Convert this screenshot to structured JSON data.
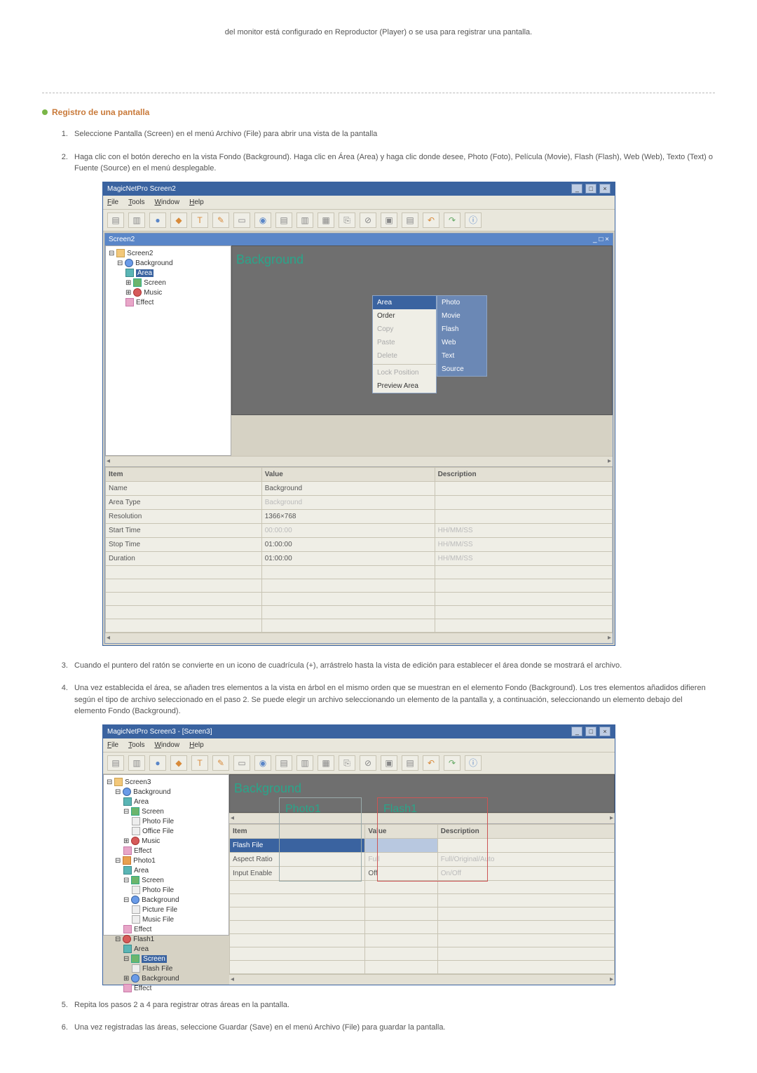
{
  "intro": "del monitor está configurado en Reproductor (Player) o se usa para registrar una pantalla.",
  "section_title": "Registro de una pantalla",
  "steps": {
    "s1": "Seleccione Pantalla (Screen) en el menú Archivo (File) para abrir una vista de la pantalla",
    "s2": "Haga clic con el botón derecho en la vista Fondo (Background). Haga clic en Área (Area) y haga clic donde desee, Photo (Foto), Película (Movie), Flash (Flash), Web (Web), Texto (Text) o Fuente (Source) en el menú desplegable.",
    "s3": "Cuando el puntero del ratón se convierte en un icono de cuadrícula (+), arrástrelo hasta la vista de edición para establecer el área donde se mostrará el archivo.",
    "s4": "Una vez establecida el área, se añaden tres elementos a la vista en árbol en el mismo orden que se muestran en el elemento Fondo (Background). Los tres elementos añadidos difieren según el tipo de archivo seleccionado en el paso 2. Se puede elegir un archivo seleccionando un elemento de la pantalla y, a continuación, seleccionando un elemento debajo del elemento Fondo (Background).",
    "s5": "Repita los pasos 2 a 4 para registrar otras áreas en la pantalla.",
    "s6": "Una vez registradas las áreas, seleccione Guardar (Save) en el menú Archivo (File) para guardar la pantalla."
  },
  "app1": {
    "title": "MagicNetPro Screen2",
    "menu": {
      "file": "File",
      "tools": "Tools",
      "window": "Window",
      "help": "Help"
    },
    "inner_title": "Screen2",
    "canvas_label": "Background",
    "tree": {
      "root": "Screen2",
      "bg": "Background",
      "area": "Area",
      "screen": "Screen",
      "music": "Music",
      "effect": "Effect"
    },
    "ctx": {
      "area": "Area",
      "order": "Order",
      "copy": "Copy",
      "paste": "Paste",
      "delete": "Delete",
      "lock": "Lock Position",
      "preview": "Preview Area"
    },
    "sub": {
      "photo": "Photo",
      "movie": "Movie",
      "flash": "Flash",
      "web": "Web",
      "text": "Text",
      "source": "Source"
    },
    "grid": {
      "h1": "Item",
      "h2": "Value",
      "h3": "Description",
      "r1c1": "Name",
      "r1c2": "Background",
      "r1c3": "",
      "r2c1": "Area Type",
      "r2c2": "Background",
      "r2c3": "",
      "r3c1": "Resolution",
      "r3c2": "1366×768",
      "r3c3": "",
      "r4c1": "Start Time",
      "r4c2": "00:00:00",
      "r4c3": "HH/MM/SS",
      "r5c1": "Stop Time",
      "r5c2": "01:00:00",
      "r5c3": "HH/MM/SS",
      "r6c1": "Duration",
      "r6c2": "01:00:00",
      "r6c3": "HH/MM/SS"
    }
  },
  "app2": {
    "title": "MagicNetPro Screen3 - [Screen3]",
    "menu": {
      "file": "File",
      "tools": "Tools",
      "window": "Window",
      "help": "Help"
    },
    "canvas_label": "Background",
    "tile1": "Photo1",
    "tile2": "Flash1",
    "tree": {
      "root": "Screen3",
      "bg": "Background",
      "area": "Area",
      "screen": "Screen",
      "photofile": "Photo File",
      "officefile": "Office File",
      "music": "Music",
      "effect": "Effect",
      "photo1": "Photo1",
      "picturefile": "Picture File",
      "musicfile": "Music File",
      "flash1": "Flash1",
      "screen_sel": "Screen",
      "flashfile": "Flash File",
      "background": "Background"
    },
    "grid": {
      "h1": "Item",
      "h2": "Value",
      "h3": "Description",
      "r1c1": "Flash File",
      "r1c2": "",
      "r1c3": "",
      "r2c1": "Aspect Ratio",
      "r2c2": "Full",
      "r2c3": "Full/Original/Auto",
      "r3c1": "Input Enable",
      "r3c2": "Off",
      "r3c3": "On/Off"
    }
  }
}
